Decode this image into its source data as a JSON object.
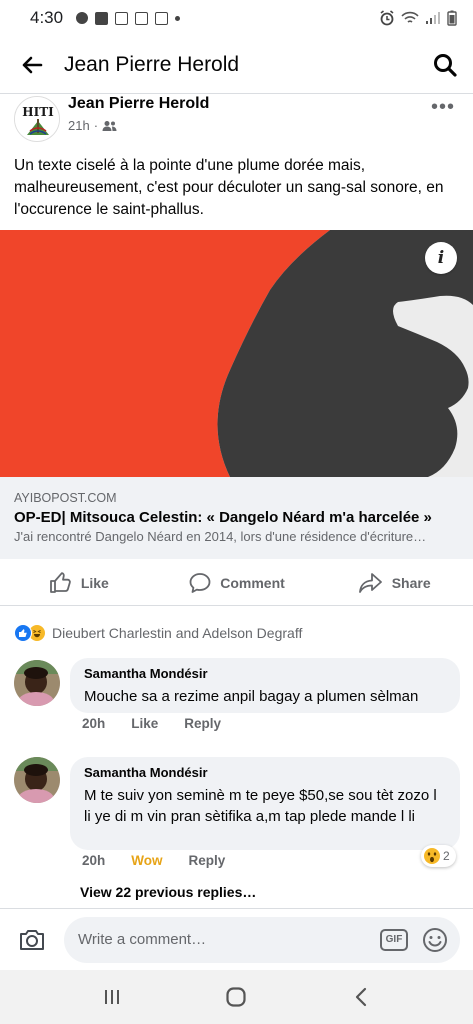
{
  "status_bar": {
    "time": "4:30"
  },
  "header": {
    "title": "Jean Pierre Herold"
  },
  "post": {
    "author": "Jean Pierre Herold",
    "time": "21h",
    "avatar_text": "HITI",
    "text": "Un texte ciselé à la pointe d'une plume dorée mais, malheureusement, c'est pour déculoter un sang-sal sonore, en l'occurence le saint-phallus.",
    "link": {
      "domain": "AYIBOPOST.COM",
      "title": "OP-ED| Mitsouca Celestin: « Dangelo Néard m'a harcelée »",
      "description": "J'ai rencontré Dangelo Néard en 2014, lors d'une résidence d'écriture…",
      "info_icon": "i"
    },
    "actions": {
      "like": "Like",
      "comment": "Comment",
      "share": "Share"
    },
    "reactions_summary": "Dieubert Charlestin and Adelson Degraff"
  },
  "comments": [
    {
      "name": "Samantha Mondésir",
      "text": "Mouche sa a rezime anpil bagay a plumen sèlman",
      "time": "20h",
      "reaction_label": "Like",
      "reply_label": "Reply"
    },
    {
      "name": "Samantha Mondésir",
      "text": "M te suiv yon seminè m te peye $50,se sou tèt zozo l li ye di m vin pran sètifika a,m tap plede mande l li",
      "time": "20h",
      "reaction_label": "Wow",
      "reply_label": "Reply",
      "reaction_count": "2"
    }
  ],
  "view_replies": "View 22 previous replies…",
  "composer": {
    "placeholder": "Write a comment…",
    "gif_label": "GIF"
  },
  "colors": {
    "facebook_blue": "#1877f2",
    "illustration_red": "#f0452a",
    "illustration_dark": "#3b3b3b",
    "illustration_light": "#ececec",
    "wow_yellow": "#e7a417"
  },
  "icons": [
    "back-arrow-icon",
    "search-icon",
    "friends-icon",
    "more-icon",
    "info-icon",
    "like-icon",
    "comment-icon",
    "share-icon",
    "camera-icon",
    "emoji-icon",
    "recent-apps-icon",
    "home-icon",
    "back-nav-icon"
  ]
}
